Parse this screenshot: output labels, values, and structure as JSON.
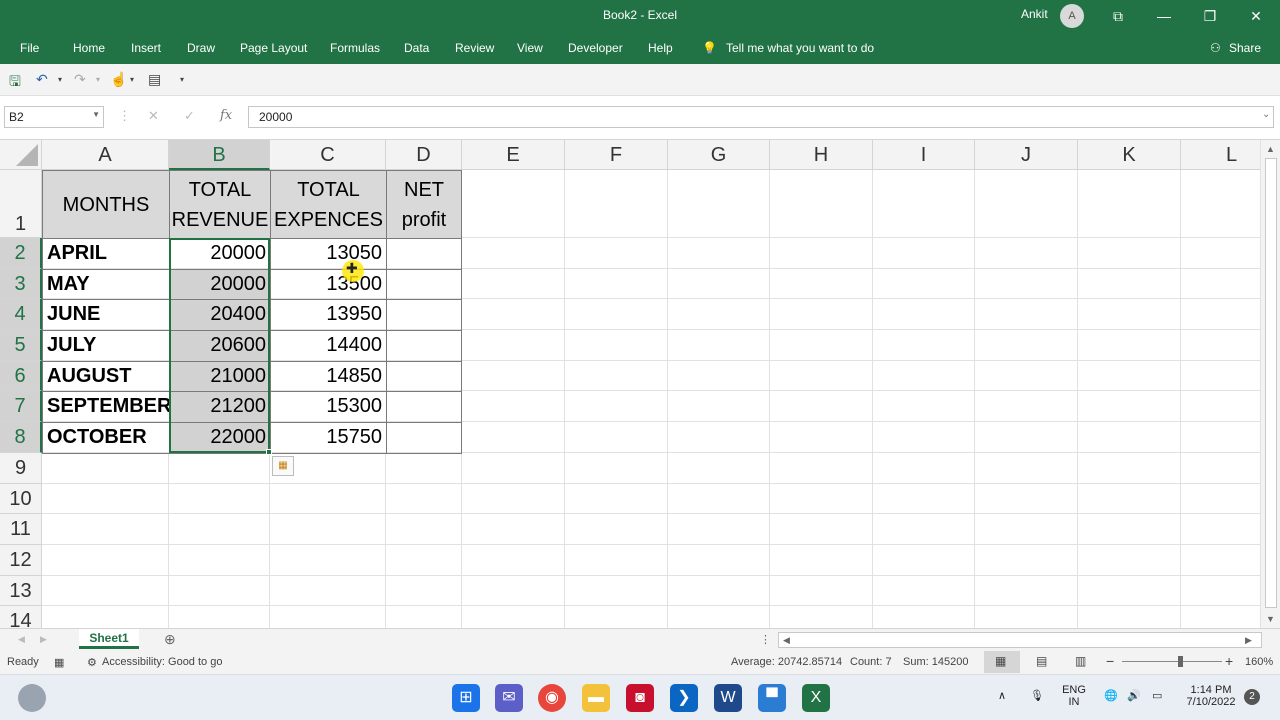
{
  "window": {
    "title": "Book2  -  Excel",
    "user": "Ankit",
    "avatar_letter": "A"
  },
  "menu": [
    "File",
    "Home",
    "Insert",
    "Draw",
    "Page Layout",
    "Formulas",
    "Data",
    "Review",
    "View",
    "Developer",
    "Help"
  ],
  "tell_me": "Tell me what you want to do",
  "share": "Share",
  "namebox": "B2",
  "formula": "20000",
  "columns": [
    "A",
    "B",
    "C",
    "D",
    "E",
    "F",
    "G",
    "H",
    "I",
    "J",
    "K",
    "L"
  ],
  "rows": [
    "1",
    "2",
    "3",
    "4",
    "5",
    "6",
    "7",
    "8",
    "9",
    "10",
    "11",
    "12",
    "13",
    "14"
  ],
  "headers": {
    "a": "MONTHS",
    "b1": "TOTAL",
    "b2": "REVENUE",
    "c1": "TOTAL",
    "c2": "EXPENCES",
    "d1": "NET",
    "d2": "profit"
  },
  "table": [
    {
      "month": "APRIL",
      "revenue": "20000",
      "expences": "13050"
    },
    {
      "month": "MAY",
      "revenue": "20000",
      "expences": "13500"
    },
    {
      "month": "JUNE",
      "revenue": "20400",
      "expences": "13950"
    },
    {
      "month": "JULY",
      "revenue": "20600",
      "expences": "14400"
    },
    {
      "month": "AUGUST",
      "revenue": "21000",
      "expences": "14850"
    },
    {
      "month": "SEPTEMBER",
      "revenue": "21200",
      "expences": "15300"
    },
    {
      "month": "OCTOBER",
      "revenue": "22000",
      "expences": "15750"
    }
  ],
  "sheet": "Sheet1",
  "status": {
    "ready": "Ready",
    "accessibility": "Accessibility: Good to go",
    "average": "Average: 20742.85714",
    "count": "Count: 7",
    "sum": "Sum: 145200",
    "zoom": "160%"
  },
  "taskbar": {
    "lang1": "ENG",
    "lang2": "IN",
    "time": "1:14 PM",
    "date": "7/10/2022",
    "badge": "2"
  },
  "colors": {
    "excel_green": "#217346",
    "selection": "#d2d2d2"
  }
}
